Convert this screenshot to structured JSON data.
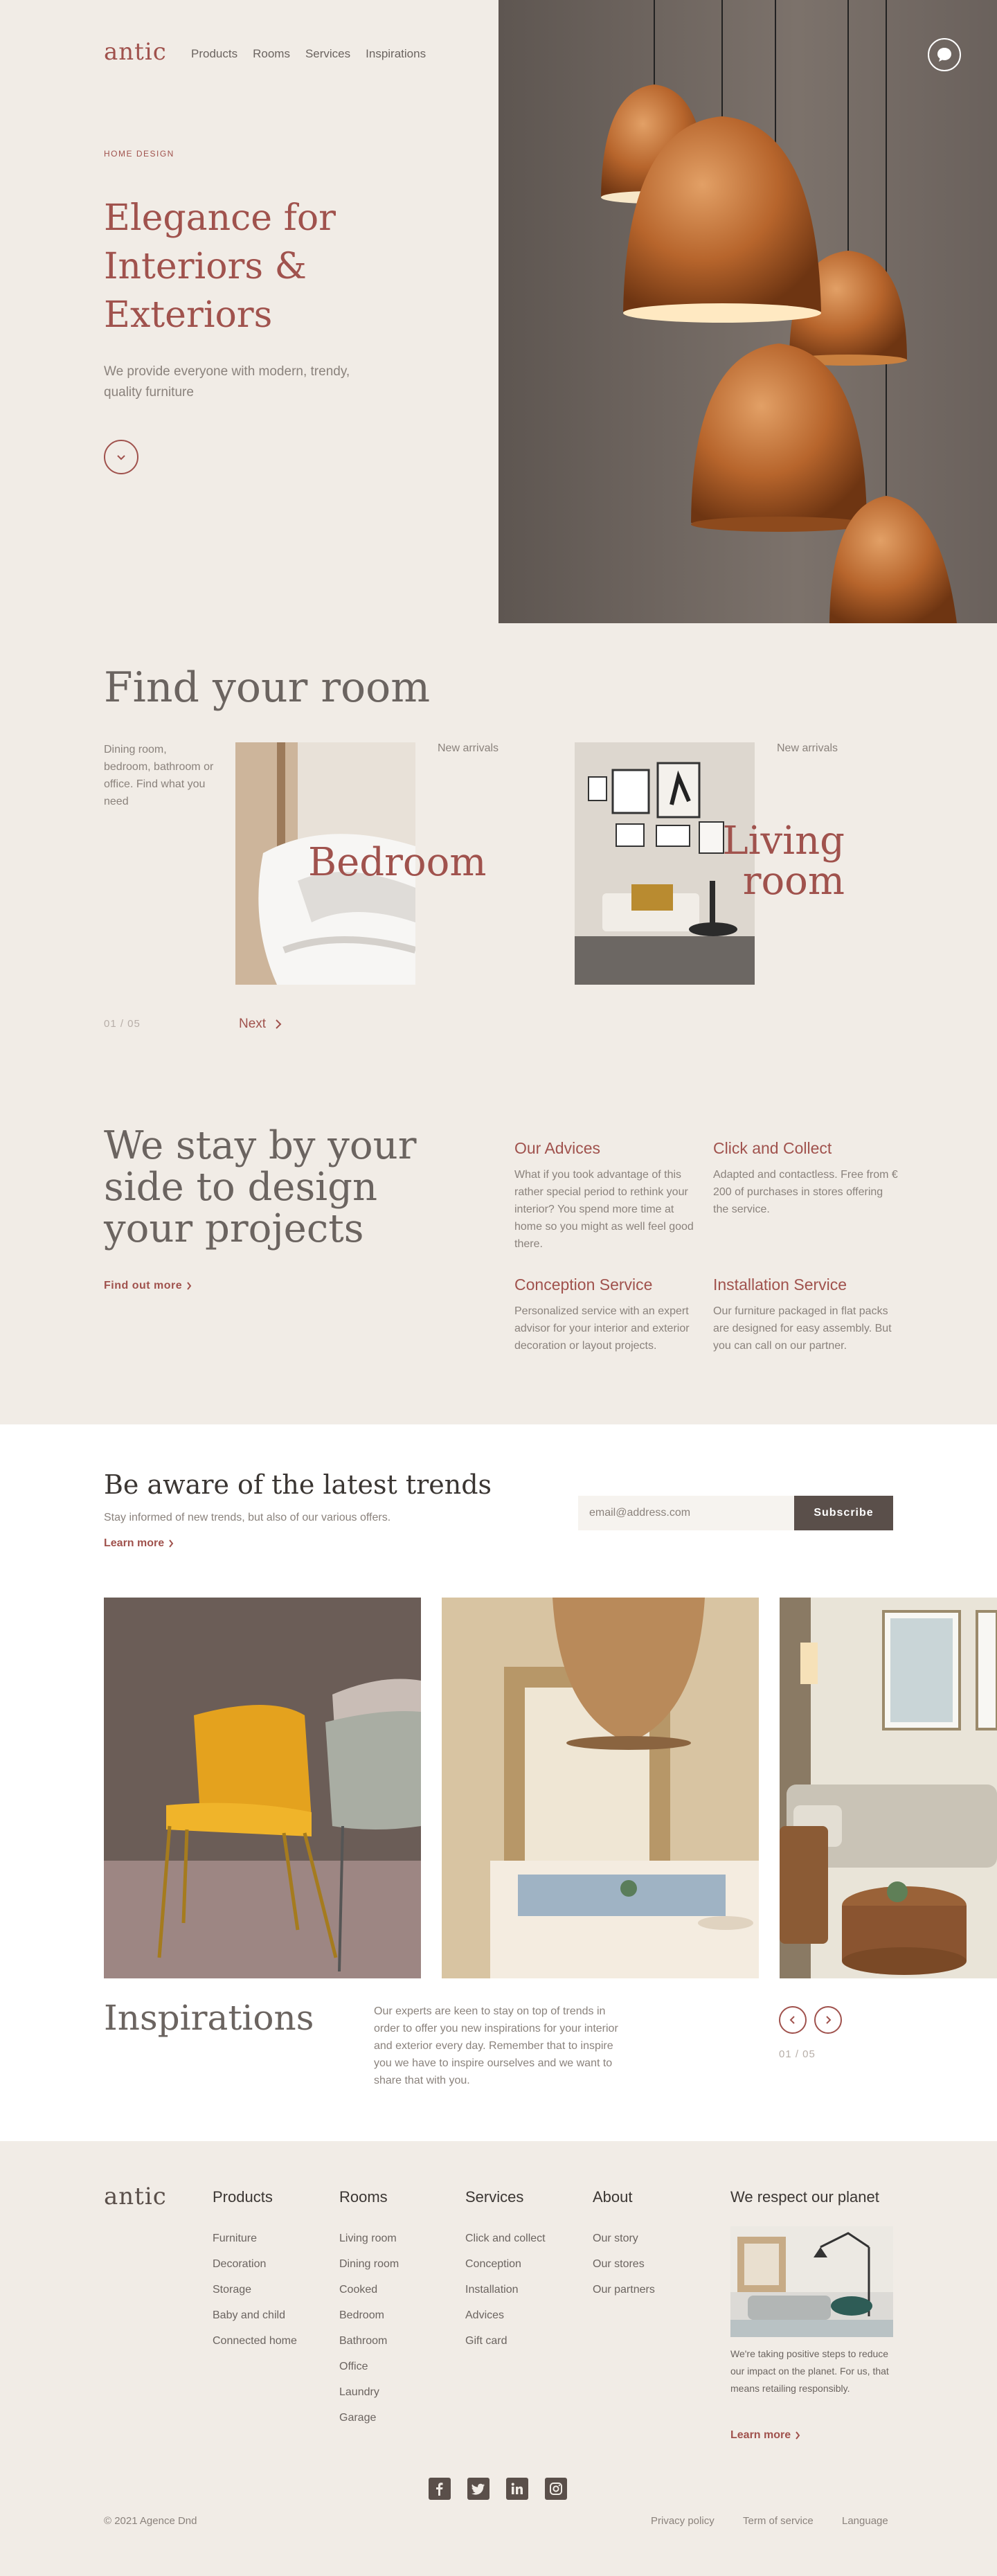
{
  "brand": {
    "logo": "antic",
    "accent": "#a0524d",
    "dark": "#5a4f4a",
    "background": "#f1ece6"
  },
  "nav": [
    "Products",
    "Rooms",
    "Services",
    "Inspirations"
  ],
  "hero": {
    "eyebrow": "HOME DESIGN",
    "title": "Elegance for Interiors & Exteriors",
    "subtitle": "We provide everyone with modern, trendy, quality furniture",
    "scroll_icon": "chevron-down-icon",
    "chat_icon": "chat-bubble-icon"
  },
  "rooms": {
    "title": "Find your room",
    "description": "Dining room, bedroom, bathroom or office. Find what you need",
    "cards": [
      {
        "tag": "New arrivals",
        "name": "Bedroom"
      },
      {
        "tag": "New arrivals",
        "name": "Living room"
      }
    ],
    "counter": "01 / 05",
    "next_label": "Next"
  },
  "services": {
    "title": "We stay by your side to design your projects",
    "cta": "Find out more",
    "items": [
      {
        "title": "Our Advices",
        "text": "What if you took advantage of this rather special period to rethink your interior? You spend more time at home so you might as well feel good there."
      },
      {
        "title": "Click and Collect",
        "text": "Adapted and contactless. Free from € 200 of purchases in stores offering the service."
      },
      {
        "title": "Conception Service",
        "text": "Personalized service with an expert advisor for your interior and exterior decoration or layout projects."
      },
      {
        "title": "Installation Service",
        "text": "Our furniture packaged in flat packs are designed for easy assembly. But you can call on our partner."
      }
    ]
  },
  "newsletter": {
    "title": "Be aware of the latest trends",
    "subtitle": "Stay informed of new trends, but also of our various offers.",
    "link": "Learn more",
    "email_placeholder": "email@address.com",
    "button": "Subscribe"
  },
  "inspirations": {
    "title": "Inspirations",
    "text": "Our experts are keen to stay on top of trends in order to offer you new inspirations for your interior and exterior every day. Remember that to inspire you we have to inspire ourselves and we want to share that with you.",
    "counter": "01 / 05"
  },
  "footer": {
    "logo": "antic",
    "columns": [
      {
        "title": "Products",
        "items": [
          "Furniture",
          "Decoration",
          "Storage",
          "Baby and child",
          "Connected home"
        ]
      },
      {
        "title": "Rooms",
        "items": [
          "Living room",
          "Dining room",
          "Cooked",
          "Bedroom",
          "Bathroom",
          "Office",
          "Laundry",
          "Garage"
        ]
      },
      {
        "title": "Services",
        "items": [
          "Click and collect",
          "Conception",
          "Installation",
          "Advices",
          "Gift card"
        ]
      },
      {
        "title": "About",
        "items": [
          "Our story",
          "Our stores",
          "Our partners"
        ]
      }
    ],
    "planet": {
      "title": "We respect our planet",
      "text": "We're taking positive steps to reduce our impact on the planet. For us, that means retailing responsibly.",
      "link": "Learn more"
    },
    "social": [
      "facebook-icon",
      "twitter-icon",
      "linkedin-icon",
      "instagram-icon"
    ],
    "copyright": "© 2021 Agence Dnd",
    "legal": [
      "Privacy policy",
      "Term of service",
      "Language"
    ]
  }
}
